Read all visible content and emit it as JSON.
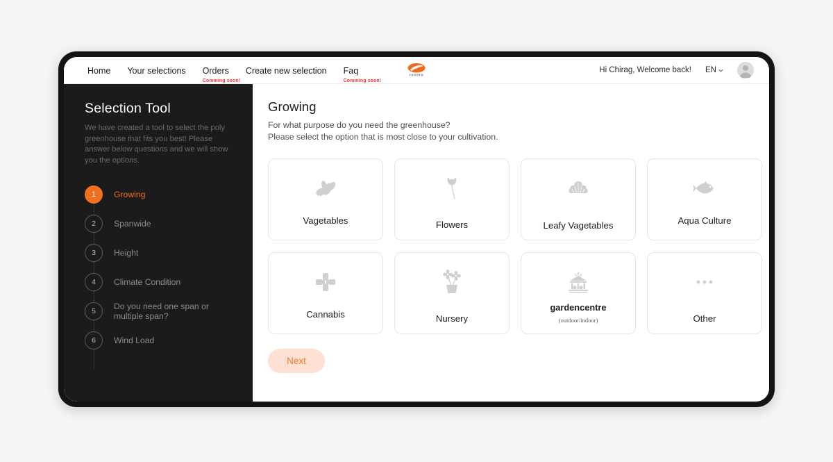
{
  "header": {
    "nav_items": [
      {
        "label": "Home",
        "note": ""
      },
      {
        "label": "Your selections",
        "note": ""
      },
      {
        "label": "Orders",
        "note": "Comming soon!"
      },
      {
        "label": "Create new selection",
        "note": ""
      },
      {
        "label": "Faq",
        "note": "Comming soon!"
      }
    ],
    "logo_text": "rovero",
    "greeting": "Hi Chirag, Welcome back!",
    "language": "EN"
  },
  "sidebar": {
    "title": "Selection Tool",
    "description": "We have created a tool to select the poly greenhouse that fits you best! Please answer below questions and we will show you the options.",
    "steps": [
      {
        "number": "1",
        "label": "Growing",
        "active": true
      },
      {
        "number": "2",
        "label": "Spanwide",
        "active": false
      },
      {
        "number": "3",
        "label": "Height",
        "active": false
      },
      {
        "number": "4",
        "label": "Climate Condition",
        "active": false
      },
      {
        "number": "5",
        "label": "Do you need one span or multiple span?",
        "active": false
      },
      {
        "number": "6",
        "label": "Wind Load",
        "active": false
      }
    ]
  },
  "main": {
    "title": "Growing",
    "subtitle_line1": "For what purpose do you need the greenhouse?",
    "subtitle_line2": "Please select the option that is most close to your cultivation.",
    "options": [
      {
        "label": "Vagetables",
        "sublabel": "",
        "icon": "vegetables-icon",
        "label_pos": "pos-a"
      },
      {
        "label": "Flowers",
        "sublabel": "",
        "icon": "tulip-icon",
        "label_pos": "pos-b"
      },
      {
        "label": "Leafy Vagetables",
        "sublabel": "",
        "icon": "lettuce-icon",
        "label_pos": "pos-c"
      },
      {
        "label": "Aqua Culture",
        "sublabel": "",
        "icon": "fish-icon",
        "label_pos": "pos-a"
      },
      {
        "label": "Cannabis",
        "sublabel": "",
        "icon": "cannabis-icon",
        "label_pos": "pos-a"
      },
      {
        "label": "Nursery",
        "sublabel": "",
        "icon": "potted-plant-icon",
        "label_pos": "pos-b"
      },
      {
        "label": "gardencentre",
        "sublabel": "(outdoor/indoor)",
        "icon": "garden-centre-icon",
        "label_pos": "pos-d"
      },
      {
        "label": "Other",
        "sublabel": "",
        "icon": "ellipsis-icon",
        "label_pos": "pos-b"
      }
    ],
    "next_label": "Next"
  },
  "colors": {
    "accent": "#f26f21",
    "accent_soft": "#fde2d3",
    "sidebar_bg": "#1b1b1b",
    "frame": "#141414",
    "soon_red": "#f23b3b",
    "icon_gray": "#cfcfcf"
  }
}
